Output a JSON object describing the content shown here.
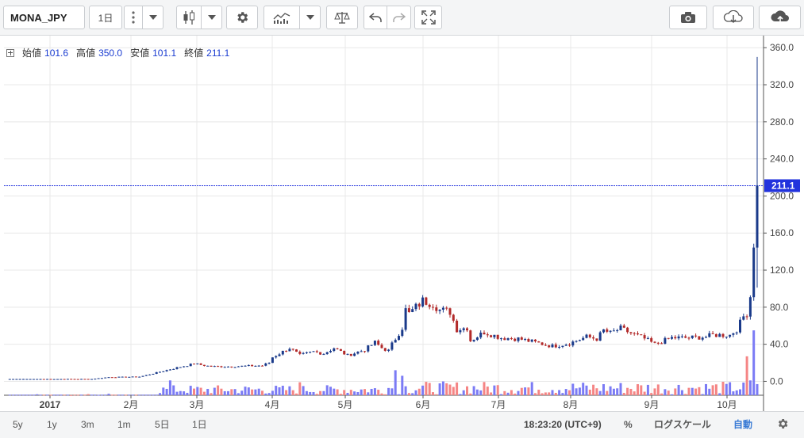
{
  "toolbar": {
    "symbol": "MONA_JPY",
    "interval": "1日"
  },
  "legend": {
    "open_label": "始値",
    "open": "101.6",
    "high_label": "高値",
    "high": "350.0",
    "low_label": "安値",
    "low": "101.1",
    "close_label": "終値",
    "close": "211.1"
  },
  "price_tag": "211.1",
  "colors": {
    "up": "#1a3a8a",
    "down": "#b22a2a",
    "vol_up": "#7b7bf5",
    "vol_down": "#f58585",
    "last_line": "#2233dd"
  },
  "bottom": {
    "ranges": [
      "5y",
      "1y",
      "3m",
      "1m",
      "5日",
      "1日"
    ],
    "time": "18:23:20 (UTC+9)",
    "percent": "%",
    "log_scale": "ログスケール",
    "auto": "自動"
  },
  "chart_data": {
    "type": "candlestick",
    "y_ticks": [
      "360.0",
      "320.0",
      "280.0",
      "240.0",
      "200.0",
      "160.0",
      "120.0",
      "80.0",
      "40.0",
      "0.0"
    ],
    "x_ticks": [
      "2017",
      "2月",
      "3月",
      "4月",
      "5月",
      "6月",
      "7月",
      "8月",
      "9月",
      "10月"
    ],
    "ylim": [
      -15,
      373
    ],
    "last_close": 211.1,
    "price_path": [
      [
        0,
        2.5
      ],
      [
        25,
        2.5
      ],
      [
        30,
        4.5
      ],
      [
        39,
        5
      ],
      [
        42,
        7.5
      ],
      [
        48,
        13
      ],
      [
        55,
        19
      ],
      [
        60,
        16
      ],
      [
        65,
        16
      ],
      [
        70,
        16.5
      ],
      [
        75,
        17
      ],
      [
        77,
        20
      ],
      [
        78,
        26
      ],
      [
        83,
        36
      ],
      [
        86,
        28
      ],
      [
        90,
        32
      ],
      [
        93,
        30
      ],
      [
        96,
        36
      ],
      [
        100,
        28
      ],
      [
        105,
        34
      ],
      [
        108,
        42
      ],
      [
        110,
        36
      ],
      [
        112,
        33
      ],
      [
        113,
        40
      ],
      [
        116,
        58
      ],
      [
        117,
        77
      ],
      [
        118,
        73
      ],
      [
        122,
        87
      ],
      [
        125,
        84
      ],
      [
        127,
        77
      ],
      [
        130,
        75
      ],
      [
        132,
        56
      ],
      [
        135,
        58
      ],
      [
        136,
        44
      ],
      [
        140,
        53
      ],
      [
        145,
        47
      ],
      [
        150,
        46
      ],
      [
        155,
        42
      ],
      [
        160,
        38
      ],
      [
        165,
        41
      ],
      [
        170,
        48
      ],
      [
        173,
        46
      ],
      [
        175,
        55
      ],
      [
        177,
        52
      ],
      [
        180,
        57
      ],
      [
        183,
        52
      ],
      [
        187,
        46
      ],
      [
        190,
        40
      ],
      [
        195,
        47
      ],
      [
        200,
        47
      ],
      [
        205,
        48
      ],
      [
        207,
        50
      ],
      [
        212,
        50
      ],
      [
        214,
        56
      ],
      [
        215,
        63
      ],
      [
        216,
        70
      ],
      [
        217,
        74
      ],
      [
        218,
        92
      ],
      [
        219,
        150
      ],
      [
        220,
        211.1
      ]
    ],
    "volume_spikes": [
      [
        48,
        16
      ],
      [
        86,
        14
      ],
      [
        114,
        27
      ],
      [
        116,
        21
      ],
      [
        200,
        8
      ],
      [
        217,
        42
      ],
      [
        218,
        16
      ],
      [
        219,
        70
      ],
      [
        220,
        12
      ]
    ]
  }
}
